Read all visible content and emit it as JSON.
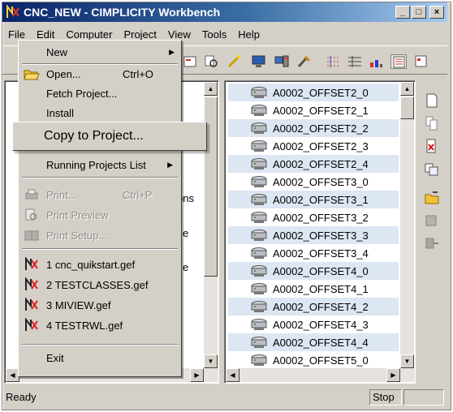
{
  "window": {
    "title": "CNC_NEW - CIMPLICITY Workbench",
    "minimize": "_",
    "maximize": "□",
    "close": "×"
  },
  "menubar": [
    "File",
    "Edit",
    "Computer",
    "Project",
    "View",
    "Tools",
    "Help"
  ],
  "file_menu": {
    "new": "New",
    "open": "Open...",
    "open_shortcut": "Ctrl+O",
    "fetch": "Fetch Project...",
    "install": "Install",
    "copy": "Copy to Project...",
    "running": "Running Projects List",
    "print": "Print...",
    "print_shortcut": "Ctrl+P",
    "preview": "Print Preview",
    "setup": "Print Setup...",
    "recent": [
      "1 cnc_quikstart.gef",
      "2 TESTCLASSES.gef",
      "3 MIVIEW.gef",
      "4 TESTRWL.gef"
    ],
    "exit": "Exit"
  },
  "left_pane_fragments": [
    "ons",
    "e",
    "e"
  ],
  "objects": [
    "A0002_OFFSET2_0",
    "A0002_OFFSET2_1",
    "A0002_OFFSET2_2",
    "A0002_OFFSET2_3",
    "A0002_OFFSET2_4",
    "A0002_OFFSET3_0",
    "A0002_OFFSET3_1",
    "A0002_OFFSET3_2",
    "A0002_OFFSET3_3",
    "A0002_OFFSET3_4",
    "A0002_OFFSET4_0",
    "A0002_OFFSET4_1",
    "A0002_OFFSET4_2",
    "A0002_OFFSET4_3",
    "A0002_OFFSET4_4",
    "A0002_OFFSET5_0"
  ],
  "status": {
    "text": "Ready",
    "mode": "Stop"
  },
  "icons": {
    "app": "cimplicity-app-icon",
    "object": "device-object-icon",
    "recent": "gef-file-icon"
  }
}
